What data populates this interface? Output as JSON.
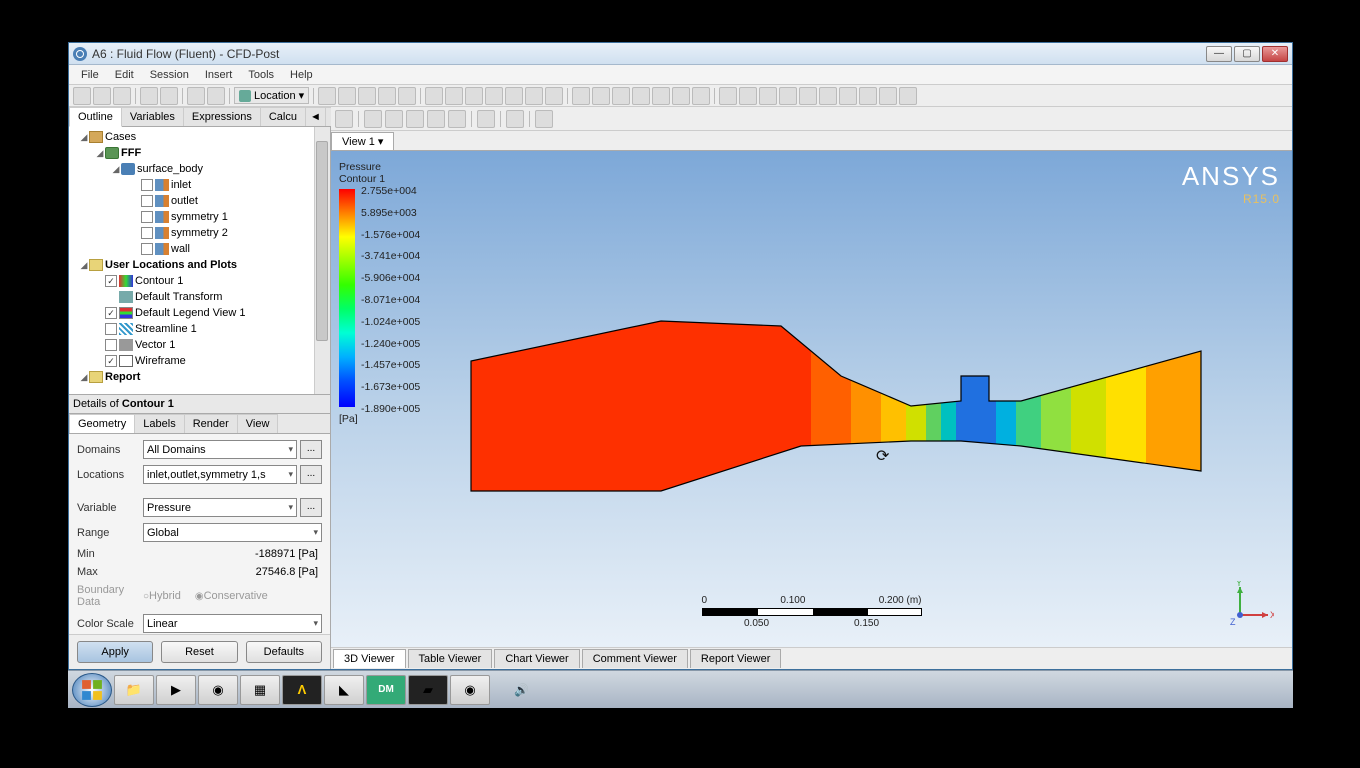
{
  "window": {
    "title": "A6 : Fluid Flow (Fluent) - CFD-Post",
    "btn_min": "—",
    "btn_max": "▢",
    "btn_close": "✕"
  },
  "menubar": [
    "File",
    "Edit",
    "Session",
    "Insert",
    "Tools",
    "Help"
  ],
  "toolbar": {
    "location_label": "Location ▾"
  },
  "outline_tabs": {
    "outline": "Outline",
    "variables": "Variables",
    "expressions": "Expressions",
    "calc": "Calcu",
    "left": "◄",
    "right": "►"
  },
  "tree": {
    "cases": "Cases",
    "fff": "FFF",
    "surface_body": "surface_body",
    "inlet": "inlet",
    "outlet": "outlet",
    "sym1": "symmetry 1",
    "sym2": "symmetry 2",
    "wall": "wall",
    "userloc": "User Locations and Plots",
    "contour1": "Contour 1",
    "deftrans": "Default Transform",
    "deflegend": "Default Legend View 1",
    "stream1": "Streamline 1",
    "vector1": "Vector 1",
    "wireframe": "Wireframe",
    "report": "Report"
  },
  "details": {
    "header_prefix": "Details of ",
    "header_item": "Contour 1",
    "tabs": {
      "geometry": "Geometry",
      "labels": "Labels",
      "render": "Render",
      "view": "View"
    },
    "domains_lbl": "Domains",
    "domains_val": "All Domains",
    "locations_lbl": "Locations",
    "locations_val": "inlet,outlet,symmetry 1,s",
    "variable_lbl": "Variable",
    "variable_val": "Pressure",
    "range_lbl": "Range",
    "range_val": "Global",
    "min_lbl": "Min",
    "min_val": "-188971 [Pa]",
    "max_lbl": "Max",
    "max_val": "27546.8 [Pa]",
    "boundary_lbl": "Boundary Data",
    "hybrid": "Hybrid",
    "conservative": "Conservative",
    "colorscale_lbl": "Color Scale",
    "colorscale_val": "Linear",
    "ellipsis": "...",
    "apply": "Apply",
    "reset": "Reset",
    "defaults": "Defaults"
  },
  "view_tab": {
    "name": "View 1 ▾"
  },
  "legend": {
    "var": "Pressure",
    "name": "Contour 1",
    "unit": "[Pa]",
    "ticks": [
      "2.755e+004",
      "5.895e+003",
      "-1.576e+004",
      "-3.741e+004",
      "-5.906e+004",
      "-8.071e+004",
      "-1.024e+005",
      "-1.240e+005",
      "-1.457e+005",
      "-1.673e+005",
      "-1.890e+005"
    ]
  },
  "brand": {
    "name": "ANSYS",
    "ver": "R15.0"
  },
  "scale": {
    "t0": "0",
    "t1": "0.100",
    "t2": "0.200 (m)",
    "b1": "0.050",
    "b2": "0.150"
  },
  "axis": {
    "x": "X",
    "y": "Y",
    "z": "Z"
  },
  "footer_tabs": {
    "v3d": "3D Viewer",
    "table": "Table Viewer",
    "chart": "Chart Viewer",
    "comment": "Comment Viewer",
    "report": "Report Viewer"
  },
  "taskbar": {
    "speaker": "🔊"
  },
  "chart_data": {
    "type": "contour",
    "variable": "Pressure",
    "unit": "Pa",
    "range": [
      -189000.0,
      27550.0
    ],
    "levels": [
      27550.0,
      5895.0,
      -15760.0,
      -37410.0,
      -59060.0,
      -80710.0,
      -102400.0,
      -124000.0,
      -145700.0,
      -167300.0,
      -189000.0
    ],
    "colormap": "rainbow"
  }
}
